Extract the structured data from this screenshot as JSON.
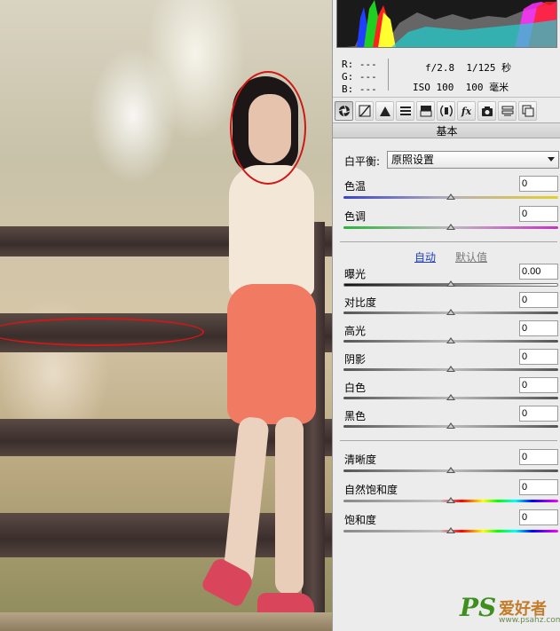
{
  "histogram": {
    "colors": [
      "#ff2020",
      "#20d020",
      "#2040ff",
      "#ffff30",
      "#30ffff",
      "#ff30ff",
      "#ffffff"
    ]
  },
  "info": {
    "r_label": "R:",
    "r_value": "---",
    "g_label": "G:",
    "g_value": "---",
    "b_label": "B:",
    "b_value": "---",
    "aperture": "f/2.8",
    "shutter": "1/125 秒",
    "iso": "ISO 100",
    "focal": "100 毫米"
  },
  "toolbar": {
    "icons": [
      "aperture-icon",
      "tone-curve-icon",
      "detail-icon",
      "hsl-icon",
      "split-toning-icon",
      "lens-corrections-icon",
      "fx-icon",
      "camera-calibration-icon",
      "presets-icon",
      "snapshots-icon"
    ],
    "fx_label": "fx"
  },
  "section": {
    "title": "基本"
  },
  "white_balance": {
    "label": "白平衡:",
    "selected": "原照设置"
  },
  "auto_link": "自动",
  "default_link": "默认值",
  "sliders": {
    "temperature": {
      "label": "色温",
      "value": "0",
      "position": 0.5
    },
    "tint": {
      "label": "色调",
      "value": "0",
      "position": 0.5
    },
    "exposure": {
      "label": "曝光",
      "value": "0.00",
      "position": 0.5
    },
    "contrast": {
      "label": "对比度",
      "value": "0",
      "position": 0.5
    },
    "highlights": {
      "label": "高光",
      "value": "0",
      "position": 0.5
    },
    "shadows": {
      "label": "阴影",
      "value": "0",
      "position": 0.5
    },
    "whites": {
      "label": "白色",
      "value": "0",
      "position": 0.5
    },
    "blacks": {
      "label": "黑色",
      "value": "0",
      "position": 0.5
    },
    "clarity": {
      "label": "清晰度",
      "value": "0",
      "position": 0.5
    },
    "vibrance": {
      "label": "自然饱和度",
      "value": "0",
      "position": 0.5
    },
    "saturation": {
      "label": "饱和度",
      "value": "0",
      "position": 0.5
    }
  },
  "watermark": {
    "ps": "PS",
    "cn": "爱好者",
    "url": "www.psahz.com"
  },
  "annotations": {
    "color": "#d01818"
  }
}
